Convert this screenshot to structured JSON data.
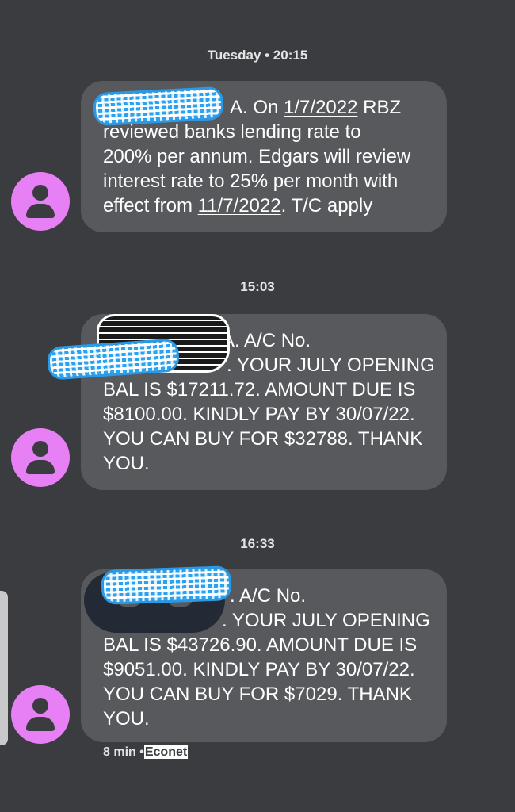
{
  "timestamps": {
    "first": "Tuesday • 20:15",
    "second": "15:03",
    "third": "16:33"
  },
  "messages": [
    {
      "lines": [
        {
          "pre": "A. On ",
          "link": "1/7/2022",
          "post": " RBZ"
        },
        {
          "text": "reviewed banks lending rate to"
        },
        {
          "text": "200% per annum. Edgars will review"
        },
        {
          "text": "interest rate to 25% per month with"
        },
        {
          "pre": "effect from ",
          "link": "11/7/2022",
          "post": ". T/C apply"
        }
      ]
    },
    {
      "lines": [
        {
          "text": "A. A/C No."
        },
        {
          "text": ". YOUR JULY OPENING"
        },
        {
          "text": "BAL IS $17211.72. AMOUNT DUE IS"
        },
        {
          "text": "$8100.00. KINDLY PAY BY 30/07/22."
        },
        {
          "text": "YOU CAN BUY FOR $32788. THANK"
        },
        {
          "text": "YOU."
        }
      ]
    },
    {
      "lines": [
        {
          "text": ". A/C No."
        },
        {
          "text": ". YOUR JULY OPENING"
        },
        {
          "text": "BAL IS $43726.90. AMOUNT DUE IS"
        },
        {
          "text": "$9051.00. KINDLY PAY BY 30/07/22."
        },
        {
          "text": "YOU CAN BUY FOR $7029. THANK"
        },
        {
          "text": "YOU."
        }
      ]
    }
  ],
  "status": {
    "age": "8 min",
    "separator": "•",
    "carrier": "Econet"
  },
  "icons": {
    "avatar": "person-avatar-icon"
  },
  "colors": {
    "background": "#3b3c40",
    "bubble": "#58595c",
    "avatar": "#e77ff5",
    "redaction": "#2aa2ef"
  }
}
